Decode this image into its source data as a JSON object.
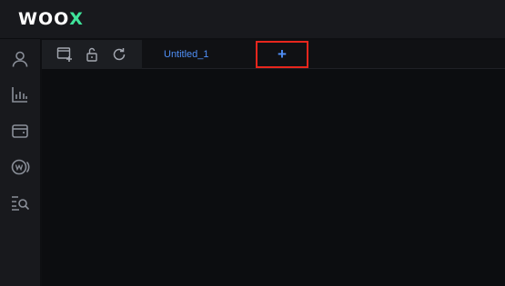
{
  "brand": {
    "logo_main": "WOO",
    "logo_accent": "X"
  },
  "sidebar": {
    "items": [
      {
        "icon": "user-icon"
      },
      {
        "icon": "bar-chart-icon"
      },
      {
        "icon": "wallet-icon"
      },
      {
        "icon": "woo-coin-icon"
      },
      {
        "icon": "search-list-icon"
      }
    ]
  },
  "toolbar": {
    "items": [
      {
        "icon": "new-window-icon"
      },
      {
        "icon": "unlock-icon"
      },
      {
        "icon": "refresh-icon"
      }
    ]
  },
  "tabs": {
    "items": [
      {
        "label": "Untitled_1"
      }
    ],
    "add_label": "+"
  },
  "colors": {
    "accent": "#4f8ff7",
    "brand_green": "#3fe39a",
    "highlight": "#e8261d"
  }
}
